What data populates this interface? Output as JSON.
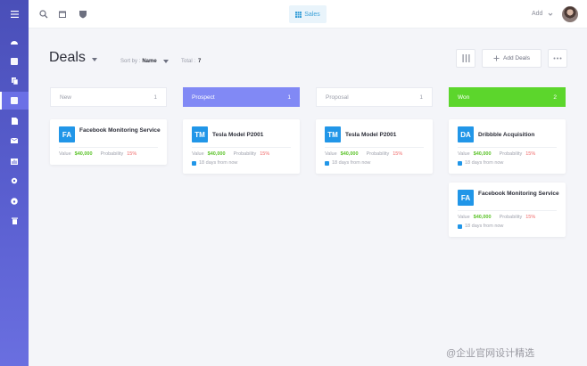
{
  "topbar": {
    "sales_label": "Sales",
    "add_label": "Add"
  },
  "page": {
    "title": "Deals",
    "sort_label": "Sort by :",
    "sort_value": "Name",
    "total_label": "Total :",
    "total_value": "7",
    "add_deals_label": "Add Deals"
  },
  "columns": [
    {
      "name": "New",
      "count": "1"
    },
    {
      "name": "Prospect",
      "count": "1"
    },
    {
      "name": "Proposal",
      "count": "1"
    },
    {
      "name": "Won",
      "count": "2"
    }
  ],
  "cards": [
    {
      "initials": "FA",
      "name": "Facebook Monitoring Service",
      "value_label": "Value",
      "value": "$40,000",
      "prob_label": "Probability",
      "prob": "15%",
      "due": ""
    },
    {
      "initials": "TM",
      "name": "Tesla Model P2001",
      "value_label": "Value",
      "value": "$40,000",
      "prob_label": "Probability",
      "prob": "15%",
      "due": "18 days from now"
    },
    {
      "initials": "TM",
      "name": "Tesla Model P2001",
      "value_label": "Value",
      "value": "$40,000",
      "prob_label": "Probability",
      "prob": "15%",
      "due": "18 days from now"
    },
    {
      "initials": "DA",
      "name": "Dribbble Acquisition",
      "value_label": "Value",
      "value": "$40,000",
      "prob_label": "Probability",
      "prob": "15%",
      "due": "18 days from now"
    },
    {
      "initials": "FA",
      "name": "Facebook Monitoring Service",
      "value_label": "Value",
      "value": "$40,000",
      "prob_label": "Probability",
      "prob": "15%",
      "due": "18 days from now"
    }
  ],
  "watermark": "@企业官网设计精选",
  "colors": {
    "sidebar": "#5a5fd0",
    "prospect": "#8189f5",
    "won": "#5cd62c",
    "badge": "#2196e8",
    "value": "#5cc32a",
    "probability": "#f06a6a"
  }
}
